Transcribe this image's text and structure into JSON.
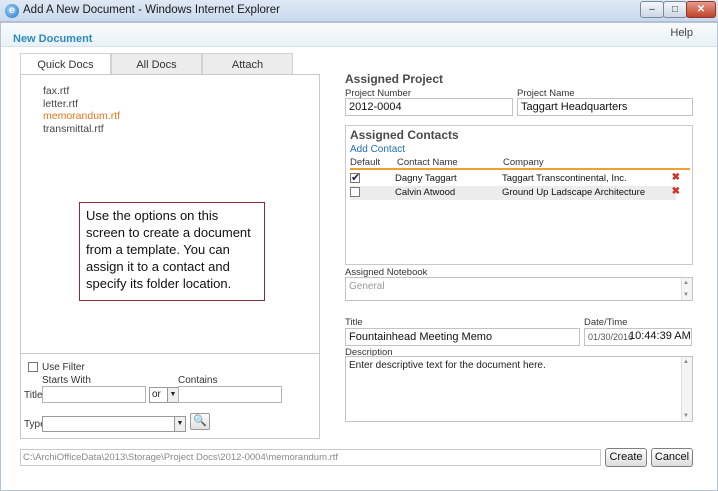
{
  "window": {
    "title": "Add A New Document - Windows Internet Explorer",
    "minimize": "–",
    "maximize": "□",
    "close": "✕"
  },
  "app": {
    "title": "New Document",
    "help": "Help"
  },
  "tabs": [
    {
      "label": "Quick Docs",
      "active": true
    },
    {
      "label": "All Docs",
      "active": false
    },
    {
      "label": "Attach",
      "active": false
    }
  ],
  "templates": [
    {
      "name": "fax.rtf",
      "selected": false
    },
    {
      "name": "letter.rtf",
      "selected": false
    },
    {
      "name": "memorandum.rtf",
      "selected": true
    },
    {
      "name": "transmittal.rtf",
      "selected": false
    }
  ],
  "tooltip": "Use the options on this screen to create a document from a template. You can assign it to a contact and specify its folder location.",
  "filter": {
    "use_filter_label": "Use Filter",
    "use_filter_checked": false,
    "starts_with_label": "Starts With",
    "contains_label": "Contains",
    "title_label": "Title",
    "starts_with_value": "",
    "operator_value": "or",
    "contains_value": "",
    "type_label": "Type",
    "type_value": ""
  },
  "assigned_project": {
    "heading": "Assigned Project",
    "number_label": "Project Number",
    "number_value": "2012-0004",
    "name_label": "Project Name",
    "name_value": "Taggart Headquarters"
  },
  "assigned_contacts": {
    "heading": "Assigned Contacts",
    "add_label": "Add Contact",
    "columns": {
      "default": "Default",
      "name": "Contact Name",
      "company": "Company"
    },
    "rows": [
      {
        "default": true,
        "name": "Dagny Taggart",
        "company": "Taggart Transcontinental, Inc.",
        "remove": "✖"
      },
      {
        "default": false,
        "name": "Calvin Atwood",
        "company": "Ground Up Ladscape Architecture",
        "remove": "✖"
      }
    ]
  },
  "notebook": {
    "label": "Assigned Notebook",
    "value": "General"
  },
  "document": {
    "title_label": "Title",
    "title_value": "Fountainhead Meeting Memo",
    "datetime_label": "Date/Time",
    "date_value": "01/30/2016",
    "time_value": "10:44:39 AM",
    "description_label": "Description",
    "description_value": "Enter descriptive text for the document here."
  },
  "footer": {
    "path": "C:\\ArchiOfficeData\\2013\\Storage\\Project Docs\\2012-0004\\memorandum.rtf",
    "create_label": "Create",
    "cancel_label": "Cancel"
  },
  "icons": {
    "browser": "e",
    "dropdown": "▼",
    "search": "🔍",
    "scroll_up": "▲",
    "scroll_down": "▼",
    "check": "✔"
  }
}
